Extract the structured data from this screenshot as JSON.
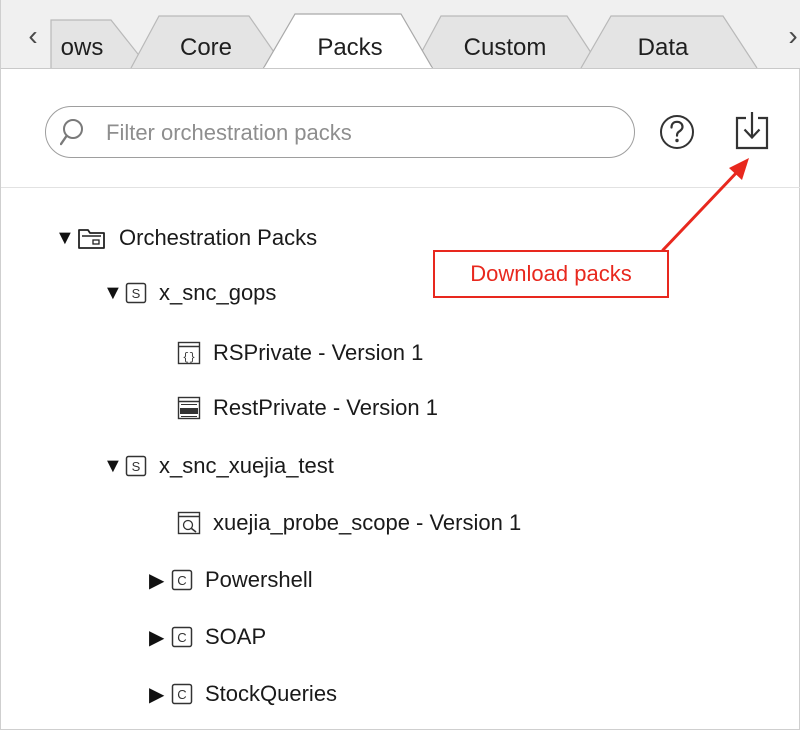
{
  "tabs": {
    "items": [
      {
        "label": "ows",
        "active": false
      },
      {
        "label": "Core",
        "active": false
      },
      {
        "label": "Packs",
        "active": true
      },
      {
        "label": "Custom",
        "active": false
      },
      {
        "label": "Data",
        "active": false
      }
    ],
    "scroll_left_glyph": "‹",
    "scroll_right_glyph": "›"
  },
  "toolbar": {
    "search_placeholder": "Filter orchestration packs",
    "search_value": "",
    "help_icon": "help-circle-icon",
    "download_icon": "download-tray-icon"
  },
  "annotation": {
    "label": "Download packs",
    "color": "#e8281e"
  },
  "tree": {
    "root": {
      "label": "Orchestration Packs",
      "icon": "folder-icon",
      "expanded": true
    },
    "nodes": [
      {
        "label": "x_snc_gops",
        "icon": "scope-s-icon",
        "expanded": true,
        "depth": 1
      },
      {
        "label": "RSPrivate - Version 1",
        "icon": "braces-file-icon",
        "depth": 2
      },
      {
        "label": "RestPrivate - Version 1",
        "icon": "rest-file-icon",
        "depth": 2
      },
      {
        "label": "x_snc_xuejia_test",
        "icon": "scope-s-icon",
        "expanded": true,
        "depth": 1
      },
      {
        "label": "xuejia_probe_scope - Version 1",
        "icon": "probe-file-icon",
        "depth": 2
      },
      {
        "label": "Powershell",
        "icon": "category-c-icon",
        "expanded": false,
        "depth": 1
      },
      {
        "label": "SOAP",
        "icon": "category-c-icon",
        "expanded": false,
        "depth": 1
      },
      {
        "label": "StockQueries",
        "icon": "category-c-icon",
        "expanded": false,
        "depth": 1
      }
    ]
  },
  "glyphs": {
    "expanded": "▼",
    "collapsed": "▶"
  }
}
